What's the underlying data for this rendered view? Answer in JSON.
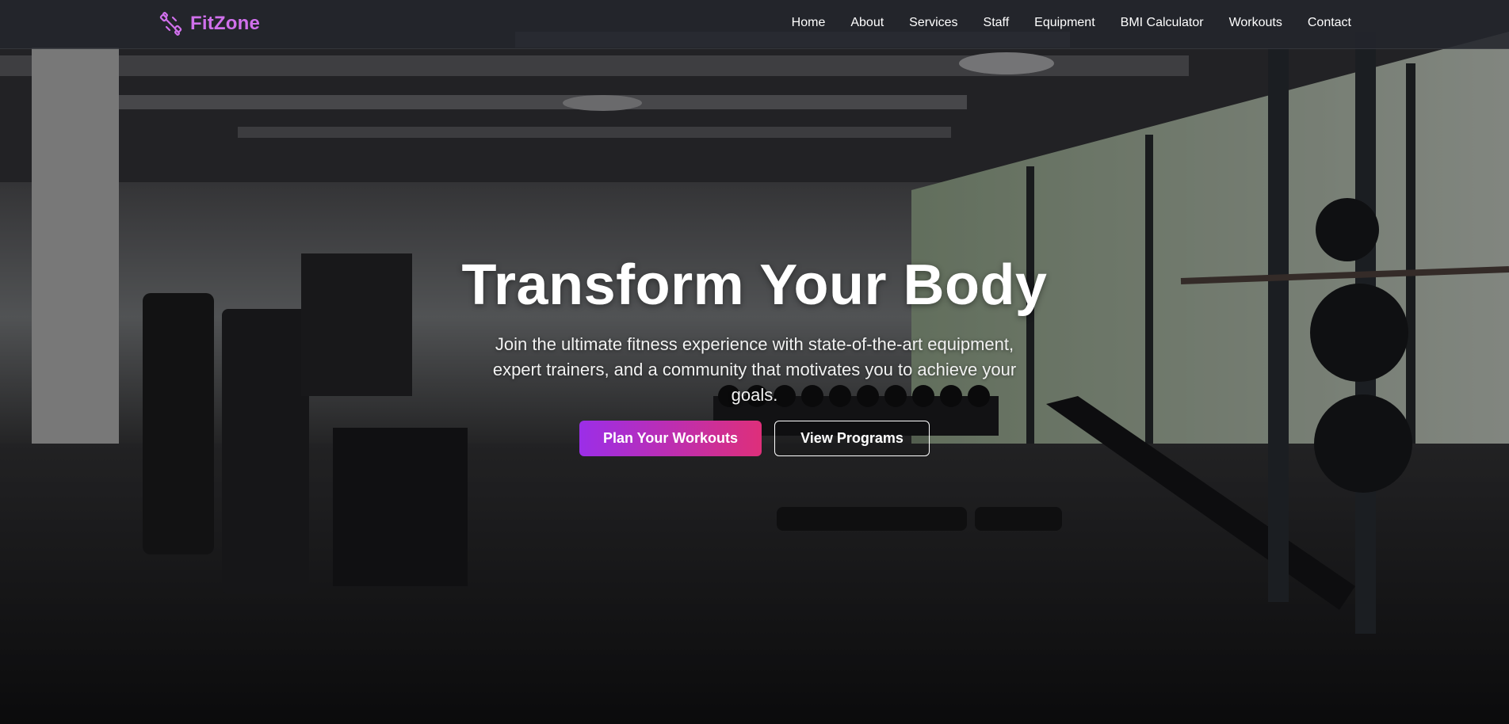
{
  "brand": {
    "name": "FitZone",
    "icon": "dumbbell-icon",
    "color": "#d070ec"
  },
  "nav": {
    "items": [
      {
        "label": "Home"
      },
      {
        "label": "About"
      },
      {
        "label": "Services"
      },
      {
        "label": "Staff"
      },
      {
        "label": "Equipment"
      },
      {
        "label": "BMI Calculator"
      },
      {
        "label": "Workouts"
      },
      {
        "label": "Contact"
      }
    ]
  },
  "hero": {
    "title": "Transform Your Body",
    "subtitle": "Join the ultimate fitness experience with state-of-the-art equipment, expert trainers, and a community that motivates you to achieve your goals.",
    "primary_button": "Plan Your Workouts",
    "secondary_button": "View Programs",
    "background": "gym-interior-photo"
  },
  "colors": {
    "gradient_start": "#9b2ee8",
    "gradient_end": "#de2f7a"
  }
}
